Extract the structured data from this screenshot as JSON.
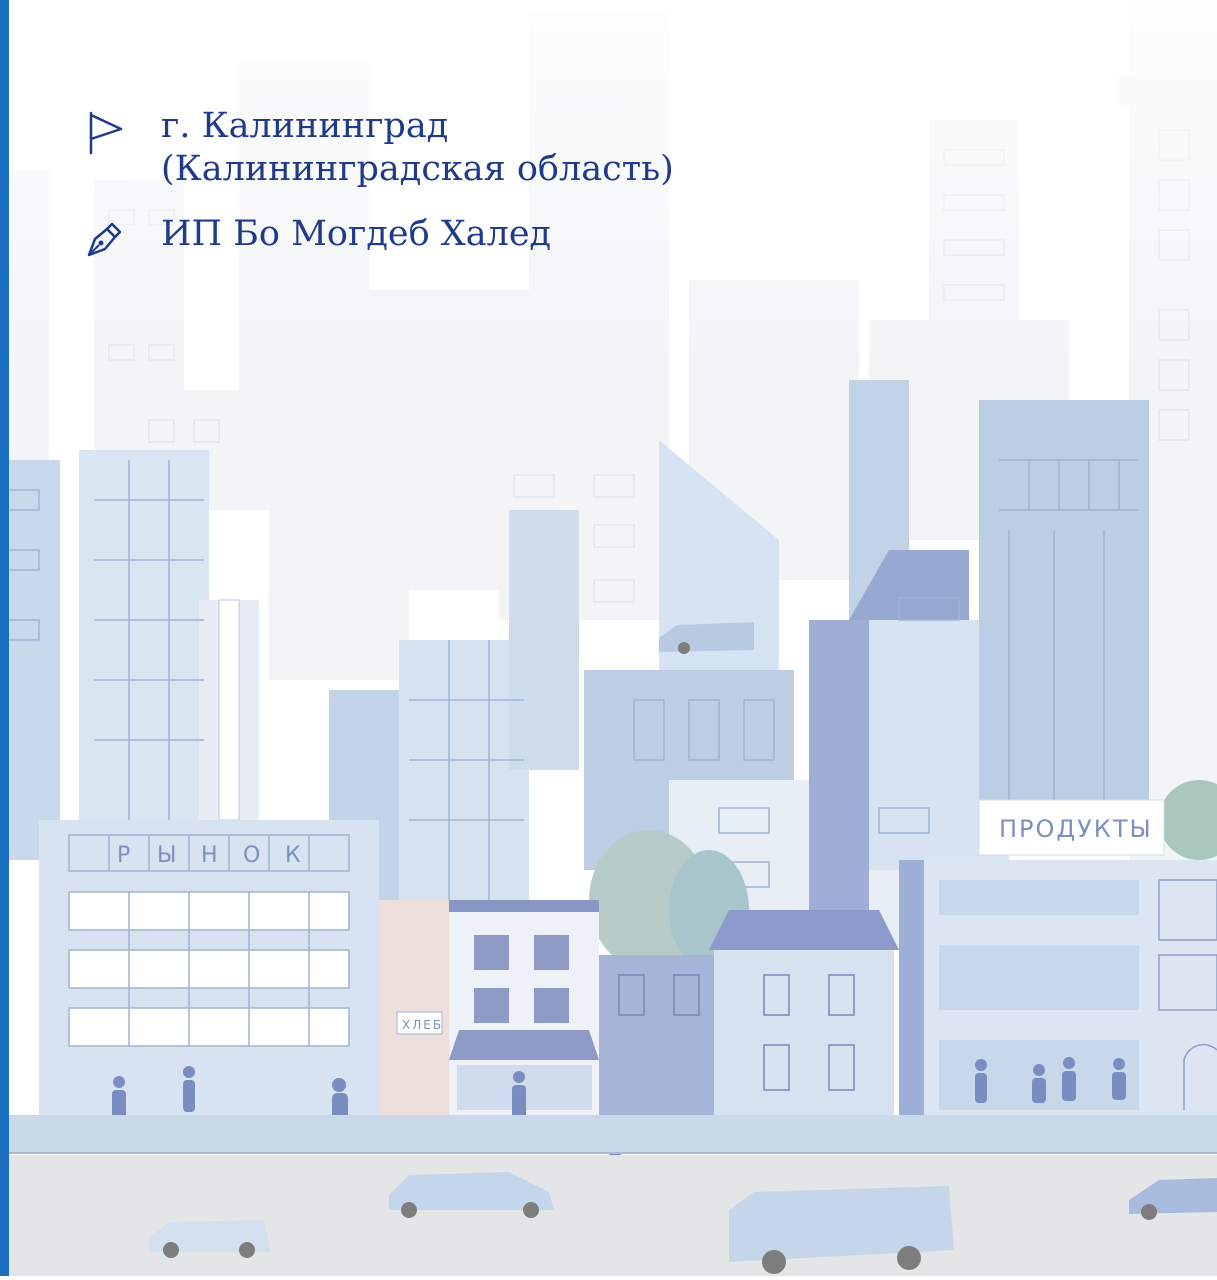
{
  "location": {
    "icon": "flag-icon",
    "line1": "г. Калининград",
    "line2": "(Калининградская область)"
  },
  "owner": {
    "icon": "pen-nib-icon",
    "name": "ИП Бо Могдеб Халед"
  },
  "illustration": {
    "market_sign": [
      "Р",
      "Ы",
      "Н",
      "О",
      "К"
    ],
    "grocery_sign": "ПРОДУКТЫ",
    "bakery_sign": "ХЛЕБ"
  },
  "colors": {
    "accent_bar": "#1b6fbf",
    "text": "#1f3a8a"
  }
}
